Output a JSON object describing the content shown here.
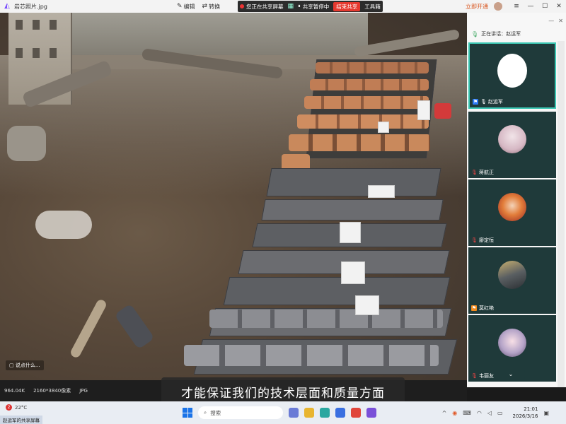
{
  "viewer": {
    "title": "岩芯照片.jpg",
    "tools": [
      {
        "icon": "edit-icon",
        "glyph": "✎",
        "label": "编辑"
      },
      {
        "icon": "convert-icon",
        "glyph": "⇄",
        "label": "转换"
      }
    ],
    "toolbox_label": "工具箱",
    "upgrade_label": "立即开通"
  },
  "share_bar": {
    "sharing_label": "您正在共享屏幕",
    "sharing_status": "共享暂停中",
    "stop_label": "结束共享"
  },
  "meeting": {
    "speaking_label": "正在讲话：赵运军",
    "participants": [
      {
        "name": "赵运军",
        "active": true,
        "icon": "host-icon"
      },
      {
        "name": "蒋航正",
        "active": false,
        "icon": "mic-muted-icon"
      },
      {
        "name": "廖定恒",
        "active": false,
        "icon": "mic-muted-icon"
      },
      {
        "name": "莫红艳",
        "active": false,
        "icon": "cohost-icon"
      },
      {
        "name": "韦丽友",
        "active": false,
        "icon": "mic-muted-icon"
      }
    ]
  },
  "photo_info": {
    "size": "964.04K",
    "dimensions": "2160*3840像素",
    "format": "JPG"
  },
  "chat_hint": "说点什么...",
  "subtitle": "才能保证我们的技术层面和质量方面",
  "taskbar": {
    "temperature": "22°C",
    "notification_count": "2",
    "share_label": "赵运军的共享屏幕",
    "search_placeholder": "搜索",
    "time": "21:01",
    "date": "2026/3/16"
  }
}
